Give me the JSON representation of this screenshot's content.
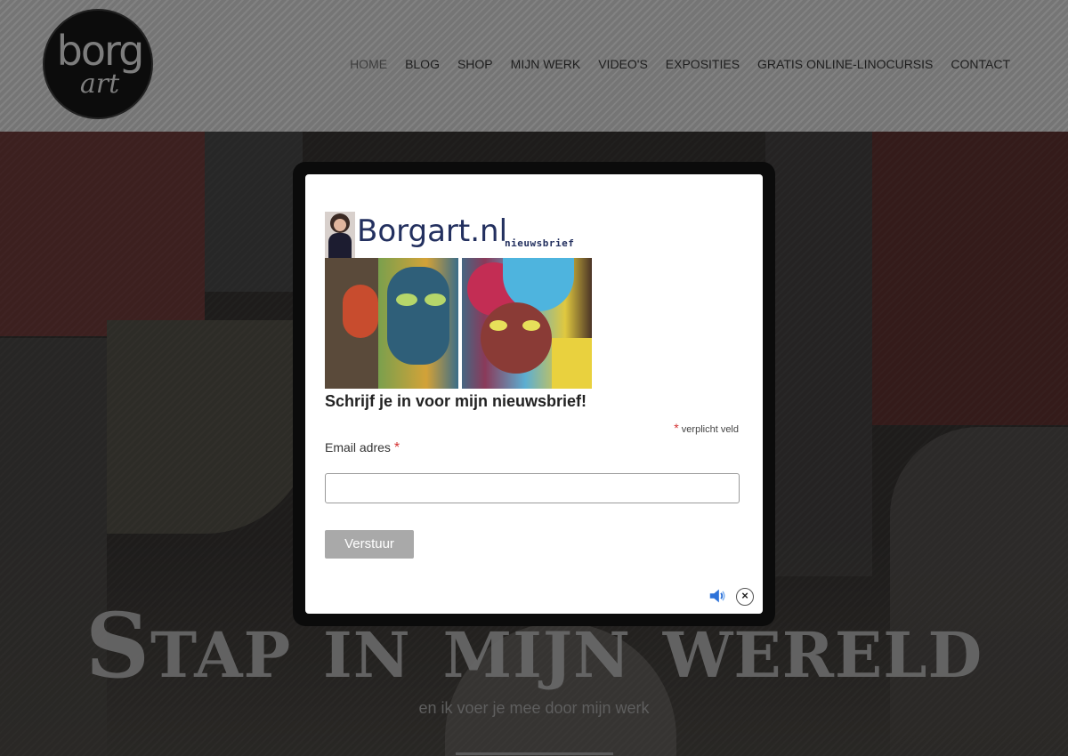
{
  "header": {
    "logo_top": "borg",
    "logo_bottom": "art",
    "nav": [
      {
        "label": "HOME",
        "active": true
      },
      {
        "label": "BLOG"
      },
      {
        "label": "SHOP"
      },
      {
        "label": "MIJN WERK"
      },
      {
        "label": "VIDEO'S"
      },
      {
        "label": "EXPOSITIES"
      },
      {
        "label": "GRATIS ONLINE-LINOCURSIS"
      },
      {
        "label": "CONTACT"
      }
    ]
  },
  "hero": {
    "title": "Stap in mijn wereld",
    "subtitle": "en ik voer je mee door mijn werk"
  },
  "modal": {
    "banner": {
      "brand": "Borgart",
      "brand_ext": ".nl",
      "tag": "nieuwsbrief"
    },
    "heading": "Schrijf je in voor mijn nieuwsbrief!",
    "required_star": "*",
    "required_note": "verplicht veld",
    "email_label": "Email adres",
    "email_value": "",
    "submit_label": "Verstuur",
    "close_glyph": "×"
  },
  "colors": {
    "header_bg": "#7a7a7a",
    "nav_text": "#1e1e1e",
    "modal_frame": "#0b0b0b",
    "required_star": "#d43232",
    "button_bg": "#a9a9a9",
    "sound_icon": "#2d72d9"
  },
  "icons": {
    "sound": "speaker-icon",
    "close": "close-icon"
  }
}
